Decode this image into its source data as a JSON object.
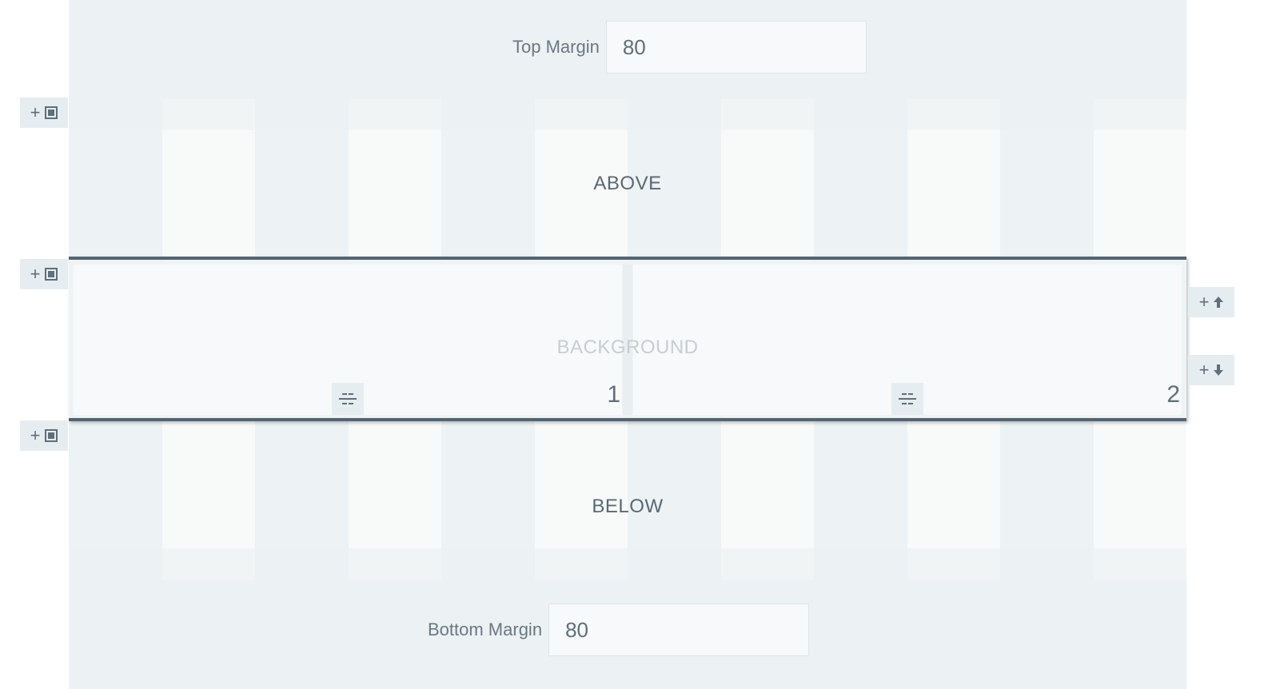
{
  "top_margin": {
    "label": "Top Margin",
    "value": "80"
  },
  "bottom_margin": {
    "label": "Bottom Margin",
    "value": "80"
  },
  "rows": {
    "above": "ABOVE",
    "below": "BELOW",
    "background": "BACKGROUND"
  },
  "columns": [
    {
      "number": "1"
    },
    {
      "number": "2"
    }
  ],
  "controls": {
    "add_symbol": "+",
    "up_arrow": "🡅",
    "down_arrow": "🡇"
  },
  "colors": {
    "border": "#546470",
    "text": "#5f6f7b",
    "canvas": "#eef3f5"
  }
}
